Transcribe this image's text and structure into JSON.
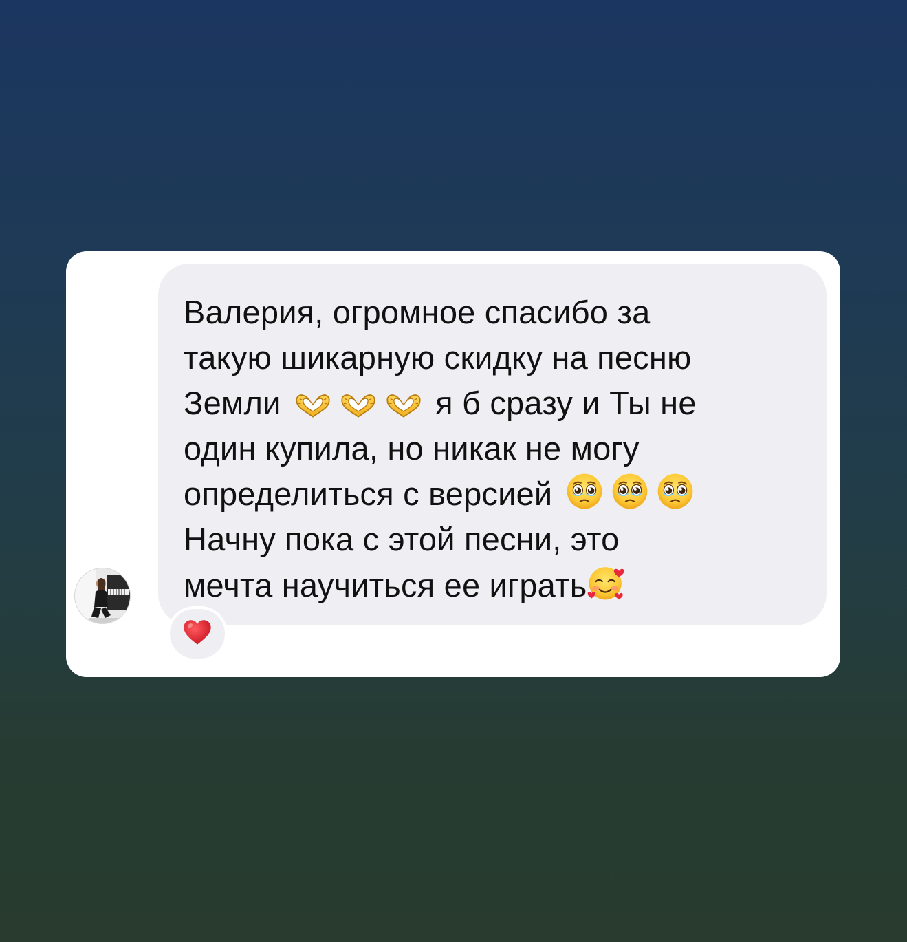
{
  "message": {
    "lines": [
      {
        "text": "Валерия, огромное спасибо за"
      },
      {
        "text": "такую шикарную скидку на песню"
      },
      {
        "before": "Земли",
        "after": "я б сразу и Ты не"
      },
      {
        "text": "один купила, но никак не могу"
      },
      {
        "before": "определиться с версией"
      },
      {
        "text": "Начну пока с этой песни, это"
      },
      {
        "before": "мечта научиться ее играть"
      }
    ],
    "emojis": {
      "heart_hands": "heart-hands-icon",
      "pleading_face": "pleading-face-icon",
      "smiling_face_with_hearts": "smiling-face-with-hearts-icon"
    }
  },
  "reaction": {
    "emoji": "red-heart-icon",
    "color": "#e0202f"
  },
  "colors": {
    "card": "#ffffff",
    "bubble": "#efeff3",
    "text": "#111111"
  }
}
